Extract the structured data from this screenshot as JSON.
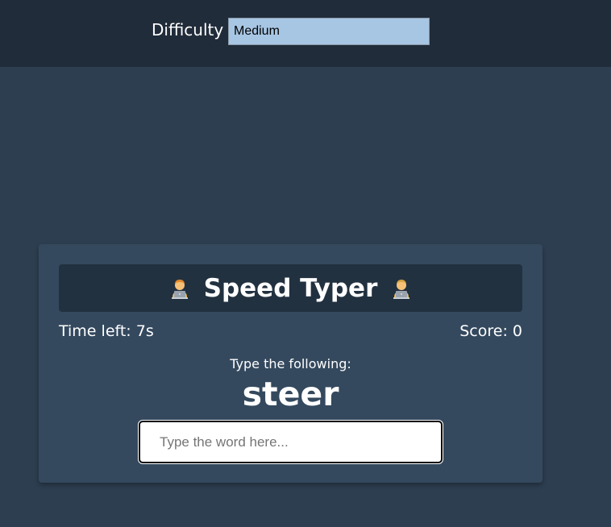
{
  "header": {
    "difficulty_label": "Difficulty",
    "difficulty_value": "Medium"
  },
  "game": {
    "title": "Speed Typer",
    "time_left": "Time left: 7s",
    "score": "Score: 0",
    "instruction": "Type the following:",
    "word": "steer",
    "input_placeholder": "Type the word here..."
  },
  "icons": {
    "left": "technologist-icon",
    "right": "technologist-icon"
  },
  "colors": {
    "page_bg": "#2d3e50",
    "topbar_bg": "#212c3a",
    "card_bg": "#34495e",
    "title_bg": "#223140",
    "select_bg": "#a7c6e4"
  }
}
